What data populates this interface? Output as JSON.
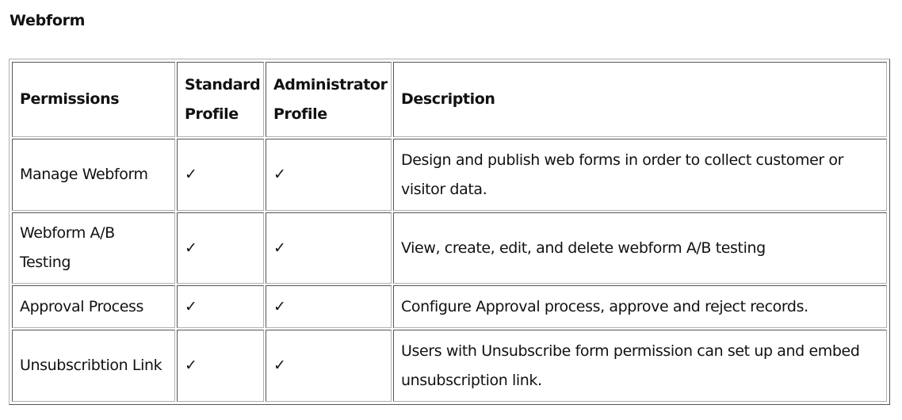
{
  "page": {
    "title": "Webform"
  },
  "table": {
    "headers": {
      "permissions": "Permissions",
      "standard_line1": "Standard",
      "standard_line2": "Profile",
      "admin_line1": "Administrator",
      "admin_line2": "Profile",
      "description": "Description"
    },
    "check_glyph": "✓",
    "rows": [
      {
        "permission": "Manage Webform",
        "standard": "✓",
        "administrator": "✓",
        "description": "Design and publish web forms in order to collect customer or visitor data."
      },
      {
        "permission": "Webform A/B Testing",
        "standard": "✓",
        "administrator": "✓",
        "description": "View, create, edit, and delete webform A/B testing"
      },
      {
        "permission": "Approval Process",
        "standard": "✓",
        "administrator": "✓",
        "description": "Configure Approval process, approve and reject records."
      },
      {
        "permission": "Unsubscribtion Link",
        "standard": "✓",
        "administrator": "✓",
        "description": "Users with Unsubscribe form permission can set up and embed unsubscription link."
      }
    ]
  }
}
